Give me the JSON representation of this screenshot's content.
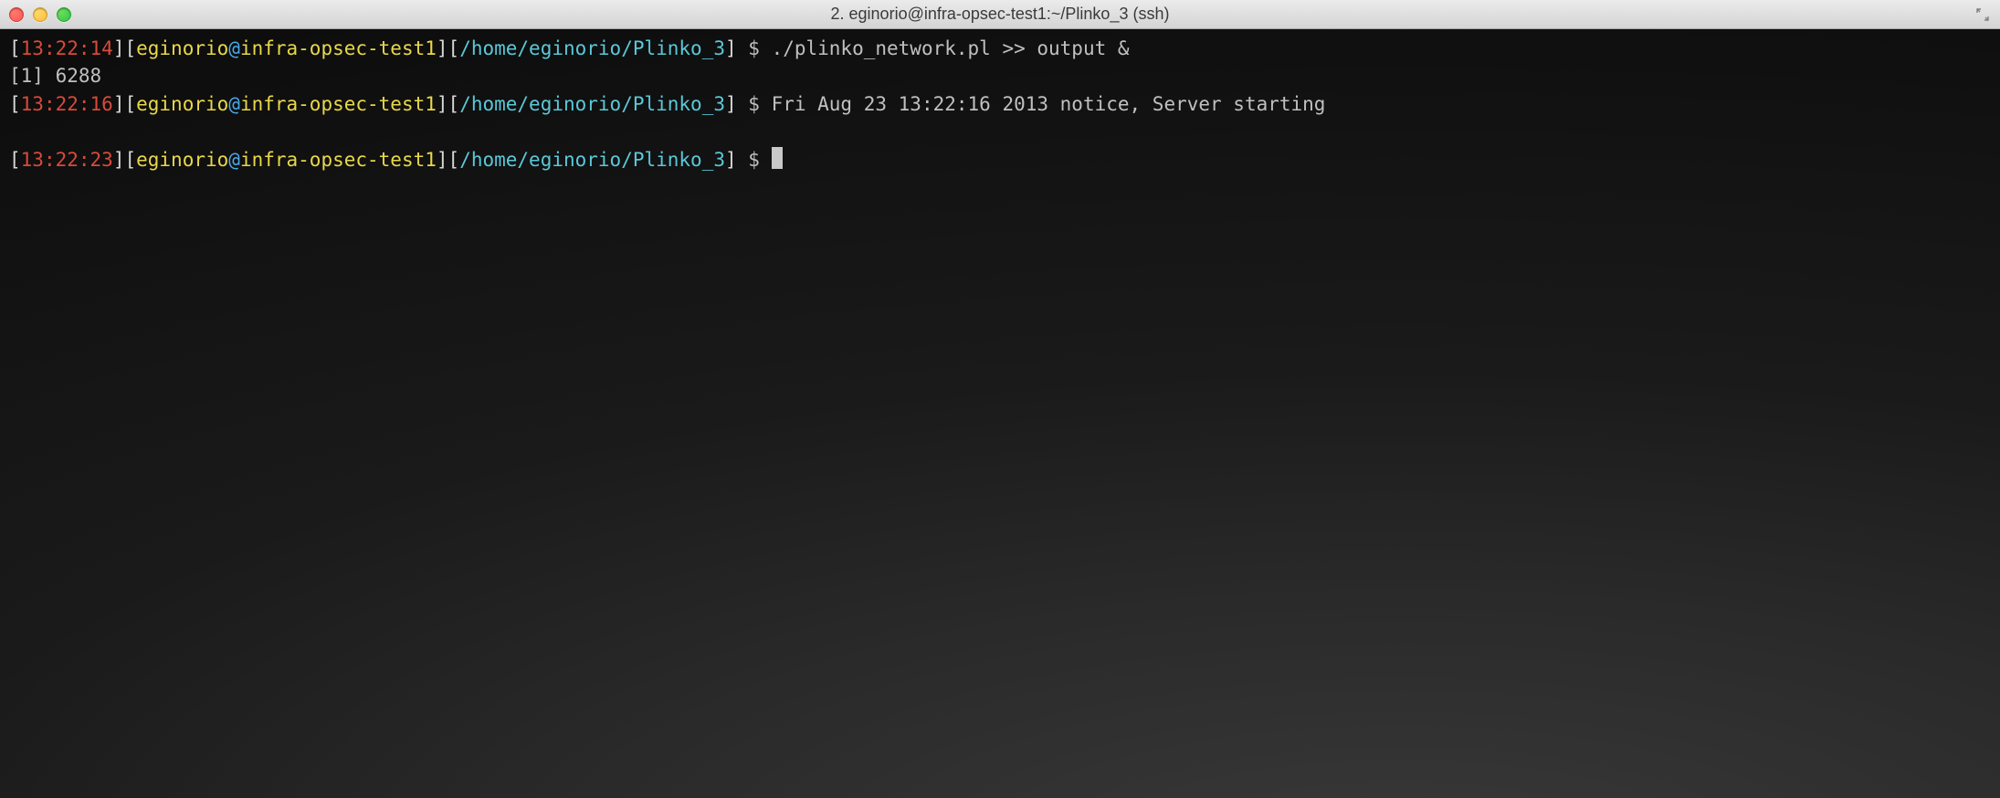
{
  "window": {
    "title": "2. eginorio@infra-opsec-test1:~/Plinko_3 (ssh)"
  },
  "colors": {
    "prompt_bracket": "#d8d8d8",
    "time": "#d94a3a",
    "user": "#e8d84a",
    "at": "#4aa8e8",
    "host": "#e8d84a",
    "path": "#5ac8d8",
    "text": "#c0c0c0"
  },
  "lines": [
    {
      "time": "13:22:14",
      "user": "eginorio",
      "at": "@",
      "host": "infra-opsec-test1",
      "path": "/home/eginorio/Plinko_3",
      "dollar": "$ ",
      "command": "./plinko_network.pl >> output &"
    },
    {
      "plain": "[1] 6288"
    },
    {
      "time": "13:22:16",
      "user": "eginorio",
      "at": "@",
      "host": "infra-opsec-test1",
      "path": "/home/eginorio/Plinko_3",
      "dollar": "$ ",
      "command": "Fri Aug 23 13:22:16 2013 notice, Server starting"
    },
    {
      "blank": true
    },
    {
      "time": "13:22:23",
      "user": "eginorio",
      "at": "@",
      "host": "infra-opsec-test1",
      "path": "/home/eginorio/Plinko_3",
      "dollar": "$ ",
      "cursor": true
    }
  ],
  "bracket_open": "[",
  "bracket_close": "]"
}
